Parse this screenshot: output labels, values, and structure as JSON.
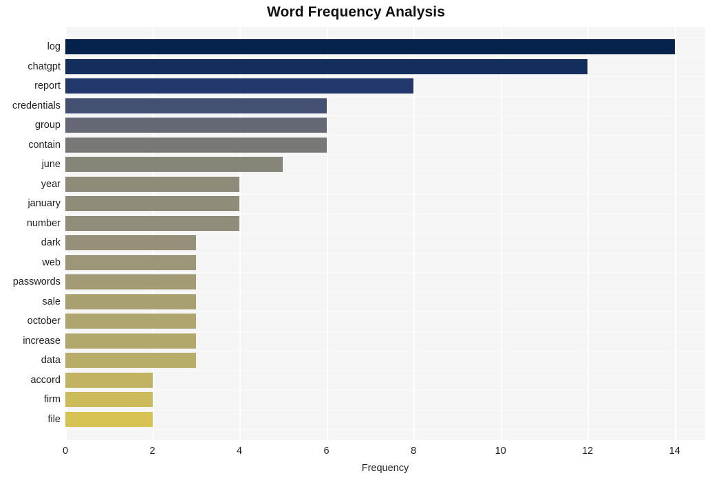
{
  "chart_data": {
    "type": "bar",
    "orientation": "horizontal",
    "title": "Word Frequency Analysis",
    "xlabel": "Frequency",
    "ylabel": "",
    "xlim": [
      0,
      14.7
    ],
    "ylim": [
      0,
      21
    ],
    "grid": true,
    "legend": null,
    "xticks": [
      0,
      2,
      4,
      6,
      8,
      10,
      12,
      14
    ],
    "xtick_labels": [
      "0",
      "2",
      "4",
      "6",
      "8",
      "10",
      "12",
      "14"
    ],
    "categories": [
      "log",
      "chatgpt",
      "report",
      "credentials",
      "group",
      "contain",
      "june",
      "year",
      "january",
      "number",
      "dark",
      "web",
      "passwords",
      "sale",
      "october",
      "increase",
      "data",
      "accord",
      "firm",
      "file"
    ],
    "values": [
      14,
      12,
      8,
      6,
      6,
      6,
      5,
      4,
      4,
      4,
      3,
      3,
      3,
      3,
      3,
      3,
      3,
      2,
      2,
      2
    ],
    "bar_colors": [
      "#04224b",
      "#23396e",
      "#6c6e76",
      "#8e8b79",
      "#918d7b",
      "#8f8b78",
      "#a29a76",
      "#ad a4 70",
      "#ada470",
      "#aca371",
      "#b7ab68",
      "#b7ab68",
      "#b7ab68",
      "#b7ab68",
      "#b8ac67",
      "#b8ac67",
      "#b8ac67",
      "#d4c255",
      "#d5c354",
      "#d6c354"
    ],
    "plot_background": "#f5f5f6",
    "grid_color": "#ffffff",
    "figure_background": "#ffffff"
  },
  "axis": {
    "x_label": "Frequency"
  }
}
